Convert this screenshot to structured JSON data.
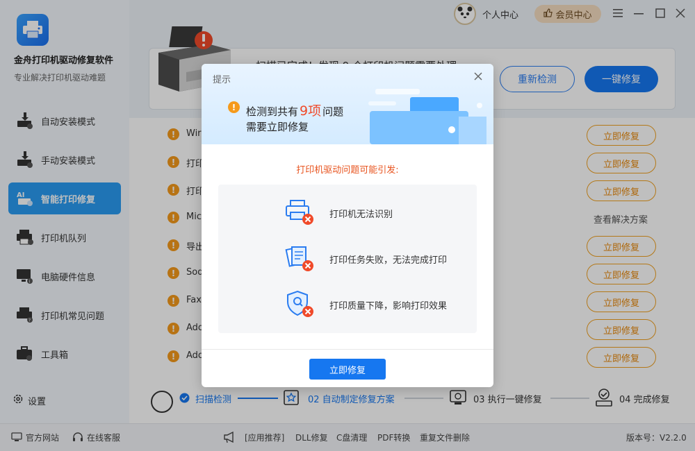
{
  "app": {
    "name": "金舟打印机驱动修复软件",
    "subtitle": "专业解决打印机驱动难题"
  },
  "titlebar": {
    "user_center": "个人中心",
    "vip_center": "会员中心"
  },
  "sidebar": {
    "items": [
      {
        "label": "自动安装模式",
        "icon": "download-printer-icon"
      },
      {
        "label": "手动安装模式",
        "icon": "manual-install-icon"
      },
      {
        "label": "智能打印修复",
        "icon": "ai-repair-icon",
        "active": true
      },
      {
        "label": "打印机队列",
        "icon": "printer-queue-icon"
      },
      {
        "label": "电脑硬件信息",
        "icon": "hardware-info-icon"
      },
      {
        "label": "打印机常见问题",
        "icon": "faq-icon"
      },
      {
        "label": "工具箱",
        "icon": "toolbox-icon"
      }
    ],
    "settings": "设置"
  },
  "banner": {
    "text": "扫描已完成！发现 9 个打印机问题需要处理",
    "recheck": "重新检测",
    "onekey_fix": "一键修复"
  },
  "list": {
    "rows": [
      {
        "name": "Wir",
        "action": "立即修复"
      },
      {
        "name": "打印",
        "action": "立即修复"
      },
      {
        "name": "打印",
        "action": "立即修复"
      },
      {
        "name": "Mic",
        "action": "查看解决方案"
      },
      {
        "name": "导出",
        "action": "立即修复"
      },
      {
        "name": "Sod",
        "action": "立即修复"
      },
      {
        "name": "Fax",
        "action": "立即修复"
      },
      {
        "name": "Ado",
        "action": "立即修复"
      },
      {
        "name": "Ado",
        "action": "立即修复"
      }
    ]
  },
  "steps": [
    {
      "label": "扫描检测",
      "state": "done"
    },
    {
      "label": "02 自动制定修复方案",
      "state": "current"
    },
    {
      "label": "03 执行一键修复",
      "state": "todo"
    },
    {
      "label": "04 完成修复",
      "state": "todo"
    }
  ],
  "footer": {
    "website": "官方网站",
    "support": "在线客服",
    "recommend": "[应用推荐]",
    "dll": "DLL修复",
    "cdisk": "C盘清理",
    "pdf": "PDF转换",
    "dup": "重复文件删除",
    "version": "版本号：V2.2.0"
  },
  "dialog": {
    "title": "提示",
    "detect_prefix": "检测到共有",
    "count": "9项",
    "detect_suffix": "问题",
    "line2": "需要立即修复",
    "cause_title": "打印机驱动问题可能引发:",
    "issues": [
      {
        "text": "打印机无法识别",
        "icon": "printer-error-icon"
      },
      {
        "text": "打印任务失败，无法完成打印",
        "icon": "document-error-icon"
      },
      {
        "text": "打印质量下降，影响打印效果",
        "icon": "quality-error-icon"
      }
    ],
    "fix_button": "立即修复"
  },
  "colors": {
    "accent": "#1677f0",
    "sidebar_active": "#2a9bf2",
    "warning": "#f59a1b",
    "error": "#f04a2a"
  }
}
